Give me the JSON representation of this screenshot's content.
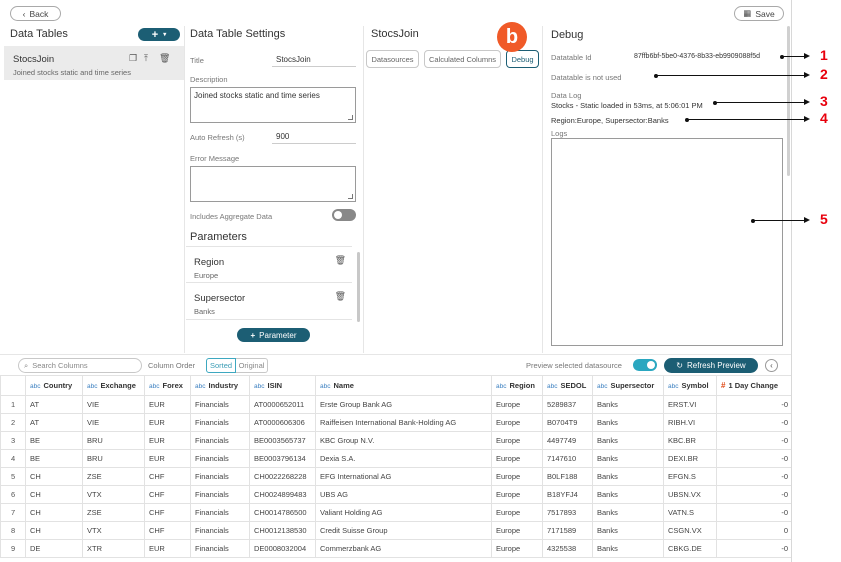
{
  "topbar": {
    "back_label": "Back",
    "save_label": "Save"
  },
  "data_tables": {
    "title": "Data Tables",
    "items": [
      {
        "name": "StocsJoin",
        "description": "Joined stocks static and time series"
      }
    ]
  },
  "settings": {
    "title": "Data Table Settings",
    "title_label": "Title",
    "title_value": "StocsJoin",
    "description_label": "Description",
    "description_value": "Joined stocks static and time series",
    "auto_refresh_label": "Auto Refresh (s)",
    "auto_refresh_value": "900",
    "error_message_label": "Error Message",
    "aggregate_label": "Includes Aggregate Data",
    "parameters_title": "Parameters",
    "parameters": [
      {
        "name": "Region",
        "value": "Europe"
      },
      {
        "name": "Supersector",
        "value": "Banks"
      }
    ],
    "add_parameter_label": "Parameter"
  },
  "join_panel": {
    "title": "StocsJoin",
    "tabs": [
      "Datasources",
      "Calculated Columns",
      "Debug"
    ],
    "active_tab": "Debug",
    "badge": "b"
  },
  "debug": {
    "title": "Debug",
    "datatable_id_label": "Datatable Id",
    "datatable_id_value": "87ffb6bf-5be0-4376-8b33-eb9909088f5d",
    "not_used_text": "Datatable is not used",
    "data_log_label": "Data Log",
    "data_log_line": "Stocks - Static loaded in 53ms, at 5:06:01 PM",
    "params_line": "Region:Europe, Supersector:Banks",
    "logs_label": "Logs"
  },
  "callouts": [
    "1",
    "2",
    "3",
    "4",
    "5"
  ],
  "toolbar": {
    "search_placeholder": "Search Columns",
    "column_order_label": "Column Order",
    "sorted_label": "Sorted",
    "original_label": "Original",
    "preview_label": "Preview selected datasource",
    "refresh_label": "Refresh Preview"
  },
  "grid": {
    "columns": [
      {
        "type": "abc",
        "name": "Country"
      },
      {
        "type": "abc",
        "name": "Exchange"
      },
      {
        "type": "abc",
        "name": "Forex"
      },
      {
        "type": "abc",
        "name": "Industry"
      },
      {
        "type": "abc",
        "name": "ISIN"
      },
      {
        "type": "abc",
        "name": "Name"
      },
      {
        "type": "abc",
        "name": "Region"
      },
      {
        "type": "abc",
        "name": "SEDOL"
      },
      {
        "type": "abc",
        "name": "Supersector"
      },
      {
        "type": "abc",
        "name": "Symbol"
      },
      {
        "type": "#",
        "name": "1 Day Change"
      }
    ],
    "rows": [
      [
        "1",
        "AT",
        "VIE",
        "EUR",
        "Financials",
        "AT0000652011",
        "Erste Group Bank AG",
        "Europe",
        "5289837",
        "Banks",
        "ERST.VI",
        "-0"
      ],
      [
        "2",
        "AT",
        "VIE",
        "EUR",
        "Financials",
        "AT0000606306",
        "Raiffeisen International Bank-Holding AG",
        "Europe",
        "B0704T9",
        "Banks",
        "RIBH.VI",
        "-0"
      ],
      [
        "3",
        "BE",
        "BRU",
        "EUR",
        "Financials",
        "BE0003565737",
        "KBC Group N.V.",
        "Europe",
        "4497749",
        "Banks",
        "KBC.BR",
        "-0"
      ],
      [
        "4",
        "BE",
        "BRU",
        "EUR",
        "Financials",
        "BE0003796134",
        "Dexia S.A.",
        "Europe",
        "7147610",
        "Banks",
        "DEXI.BR",
        "-0"
      ],
      [
        "5",
        "CH",
        "ZSE",
        "CHF",
        "Financials",
        "CH0022268228",
        "EFG International AG",
        "Europe",
        "B0LF188",
        "Banks",
        "EFGN.S",
        "-0"
      ],
      [
        "6",
        "CH",
        "VTX",
        "CHF",
        "Financials",
        "CH0024899483",
        "UBS AG",
        "Europe",
        "B18YFJ4",
        "Banks",
        "UBSN.VX",
        "-0"
      ],
      [
        "7",
        "CH",
        "ZSE",
        "CHF",
        "Financials",
        "CH0014786500",
        "Valiant Holding AG",
        "Europe",
        "7517893",
        "Banks",
        "VATN.S",
        "-0"
      ],
      [
        "8",
        "CH",
        "VTX",
        "CHF",
        "Financials",
        "CH0012138530",
        "Credit Suisse Group",
        "Europe",
        "7171589",
        "Banks",
        "CSGN.VX",
        "0"
      ],
      [
        "9",
        "DE",
        "XTR",
        "EUR",
        "Financials",
        "DE0008032004",
        "Commerzbank AG",
        "Europe",
        "4325538",
        "Banks",
        "CBKG.DE",
        "-0"
      ]
    ]
  }
}
